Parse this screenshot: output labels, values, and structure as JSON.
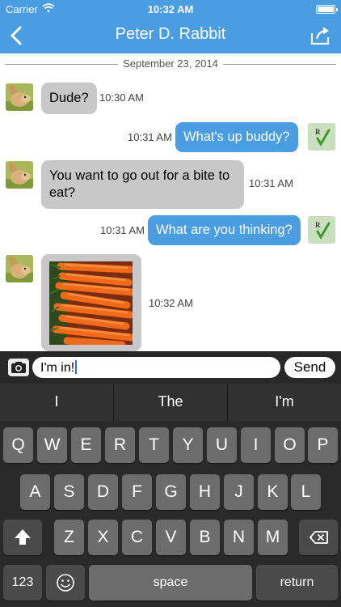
{
  "status_bar": {
    "carrier": "Carrier",
    "time": "10:32 AM"
  },
  "nav": {
    "title": "Peter D. Rabbit"
  },
  "date_separator": "September 23, 2014",
  "messages": [
    {
      "direction": "incoming",
      "text": "Dude?",
      "time": "10:30 AM"
    },
    {
      "direction": "outgoing",
      "text": "What's up buddy?",
      "time": "10:31 AM"
    },
    {
      "direction": "incoming",
      "text_lines": [
        "You want to go out for a bite to",
        "eat?"
      ],
      "time": "10:31 AM"
    },
    {
      "direction": "outgoing",
      "text": "What are you thinking?",
      "time": "10:31 AM"
    },
    {
      "direction": "incoming",
      "image": "carrots-photo",
      "time": "10:32 AM"
    }
  ],
  "composer": {
    "value": "I'm in!",
    "send_label": "Send"
  },
  "keyboard": {
    "suggestions": [
      "I",
      "The",
      "I'm"
    ],
    "row1": [
      "Q",
      "W",
      "E",
      "R",
      "T",
      "Y",
      "U",
      "I",
      "O",
      "P"
    ],
    "row2": [
      "A",
      "S",
      "D",
      "F",
      "G",
      "H",
      "J",
      "K",
      "L"
    ],
    "row3": [
      "Z",
      "X",
      "C",
      "V",
      "B",
      "N",
      "M"
    ],
    "numbers_label": "123",
    "space_label": "space",
    "return_label": "return"
  },
  "colors": {
    "accent": "#4a9de0",
    "incoming_bubble": "#c8c8c8",
    "keyboard_bg": "#2a2a2a"
  }
}
